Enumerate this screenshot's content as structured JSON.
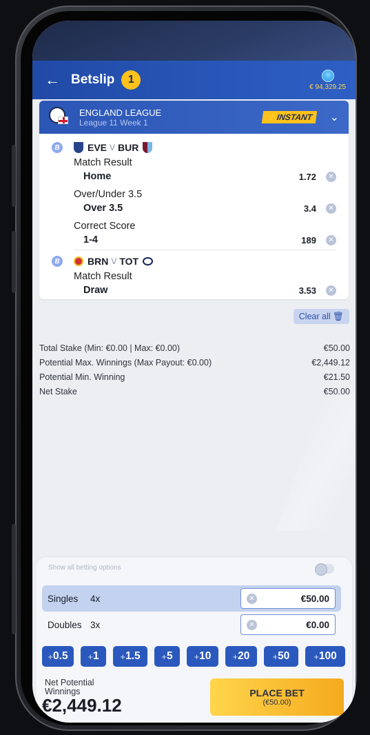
{
  "header": {
    "title": "Betslip",
    "count": "1",
    "balance": "€ 94,329.25",
    "back_icon": "arrow-left-icon"
  },
  "league": {
    "name": "ENGLAND LEAGUE",
    "sub": "League 11 Week 1",
    "badge": "INSTANT"
  },
  "matches": [
    {
      "badge": "B",
      "home": "EVE",
      "vs": "V",
      "away": "BUR",
      "markets": [
        {
          "market": "Match Result",
          "selection": "Home",
          "odds": "1.72"
        },
        {
          "market": "Over/Under 3.5",
          "selection": "Over 3.5",
          "odds": "3.4"
        },
        {
          "market": "Correct Score",
          "selection": "1-4",
          "odds": "189"
        }
      ]
    },
    {
      "badge": "B",
      "home": "BRN",
      "vs": "V",
      "away": "TOT",
      "markets": [
        {
          "market": "Match Result",
          "selection": "Draw",
          "odds": "3.53"
        }
      ]
    }
  ],
  "clear_all": "Clear all",
  "summary": [
    {
      "label": "Total Stake (Min: €0.00 | Max: €0.00)",
      "value": "€50.00"
    },
    {
      "label": "Potential Max. Winnings (Max Payout: €0.00)",
      "value": "€2,449.12"
    },
    {
      "label": "Potential Min. Winning",
      "value": "€21.50"
    },
    {
      "label": "Net Stake",
      "value": "€50.00"
    }
  ],
  "options": {
    "show_all": "Show all betting options",
    "toggle_on": false
  },
  "stakes": [
    {
      "label": "Singles",
      "mult": "4x",
      "value": "€50.00"
    },
    {
      "label": "Doubles",
      "mult": "3x",
      "value": "€0.00"
    }
  ],
  "quick": [
    {
      "plus": "+",
      "amount": "0.5"
    },
    {
      "plus": "+",
      "amount": "1"
    },
    {
      "plus": "+",
      "amount": "1.5"
    },
    {
      "plus": "+",
      "amount": "5"
    },
    {
      "plus": "+",
      "amount": "10"
    },
    {
      "plus": "+",
      "amount": "20"
    },
    {
      "plus": "+",
      "amount": "50"
    },
    {
      "plus": "+",
      "amount": "100"
    }
  ],
  "net_potential": {
    "label": "Net Potential Winnings",
    "value": "€2,449.12"
  },
  "place_bet": {
    "label": "PLACE BET",
    "sub": "(€50.00)"
  },
  "colors": {
    "primary": "#2a58bd",
    "accent": "#ffc21a"
  }
}
